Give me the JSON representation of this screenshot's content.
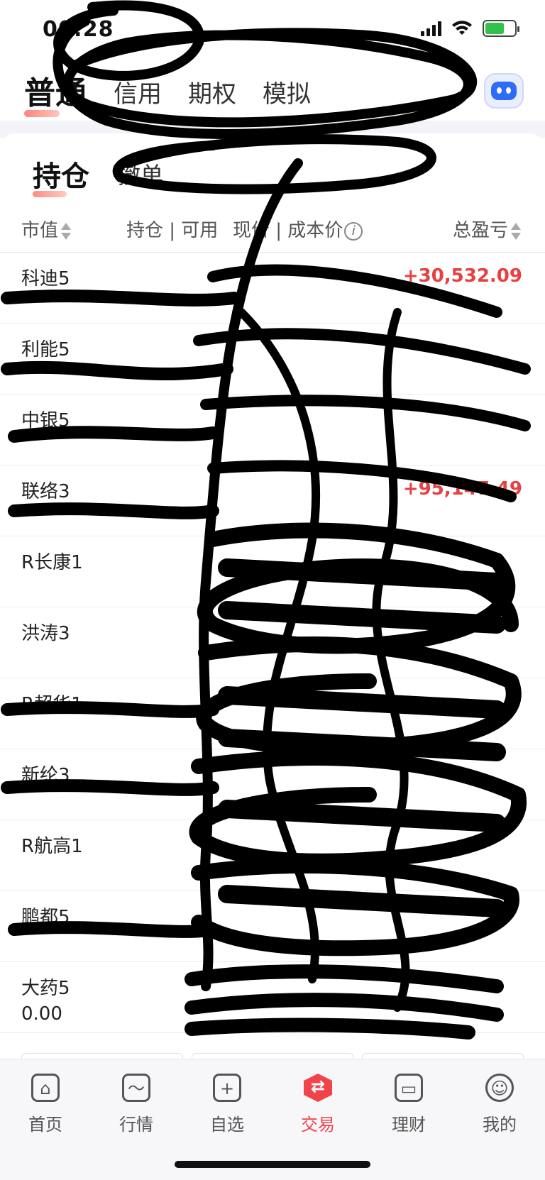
{
  "status_bar": {
    "time": "00:28"
  },
  "account_tabs": [
    {
      "label": "普通",
      "active": true
    },
    {
      "label": "信用",
      "active": false
    },
    {
      "label": "期权",
      "active": false
    },
    {
      "label": "模拟",
      "active": false
    }
  ],
  "position_tabs": [
    {
      "label": "持仓",
      "active": true
    },
    {
      "label": "撤单",
      "active": false
    }
  ],
  "columns": {
    "market_value": "市值",
    "holding_available": "持仓 | 可用",
    "price_cost": "现价 | 成本价",
    "total_pnl": "总盈亏"
  },
  "holdings": [
    {
      "name": "科迪5",
      "market_value": "",
      "total_pnl": "+30,532.09",
      "pnl_pct": "",
      "direction": "up"
    },
    {
      "name": "利能5",
      "market_value": "",
      "total_pnl": "",
      "pnl_pct": "",
      "direction": "up"
    },
    {
      "name": "中银5",
      "market_value": "",
      "total_pnl": "",
      "pnl_pct": "",
      "direction": "up"
    },
    {
      "name": "联络3",
      "market_value": "",
      "total_pnl": "+95,147.49",
      "pnl_pct": "",
      "direction": "up"
    },
    {
      "name": "R长康1",
      "market_value": "",
      "total_pnl": "",
      "pnl_pct": "",
      "direction": "down"
    },
    {
      "name": "洪涛3",
      "market_value": "",
      "total_pnl": "",
      "pnl_pct": "",
      "direction": "down"
    },
    {
      "name": "R超华1",
      "market_value": "",
      "total_pnl": "",
      "pnl_pct": "",
      "direction": "down"
    },
    {
      "name": "新纶3",
      "market_value": "",
      "total_pnl": "",
      "pnl_pct": "",
      "direction": "down"
    },
    {
      "name": "R航高1",
      "market_value": "",
      "total_pnl": "",
      "pnl_pct": "",
      "direction": "down"
    },
    {
      "name": "鹏都5",
      "market_value": "",
      "total_pnl": "",
      "pnl_pct": "",
      "direction": "down"
    },
    {
      "name": "大药5",
      "market_value": "0.00",
      "total_pnl": "",
      "pnl_pct": "",
      "direction": "down"
    }
  ],
  "bottom_nav": [
    {
      "label": "首页",
      "icon": "home-icon",
      "active": false
    },
    {
      "label": "行情",
      "icon": "market-chart-icon",
      "active": false
    },
    {
      "label": "自选",
      "icon": "add-watchlist-icon",
      "active": false
    },
    {
      "label": "交易",
      "icon": "trade-icon",
      "active": true
    },
    {
      "label": "理财",
      "icon": "wallet-icon",
      "active": false
    },
    {
      "label": "我的",
      "icon": "profile-icon",
      "active": false
    }
  ],
  "colors": {
    "up": "#e84040",
    "down": "#1aa670",
    "accent": "#f0434a"
  }
}
